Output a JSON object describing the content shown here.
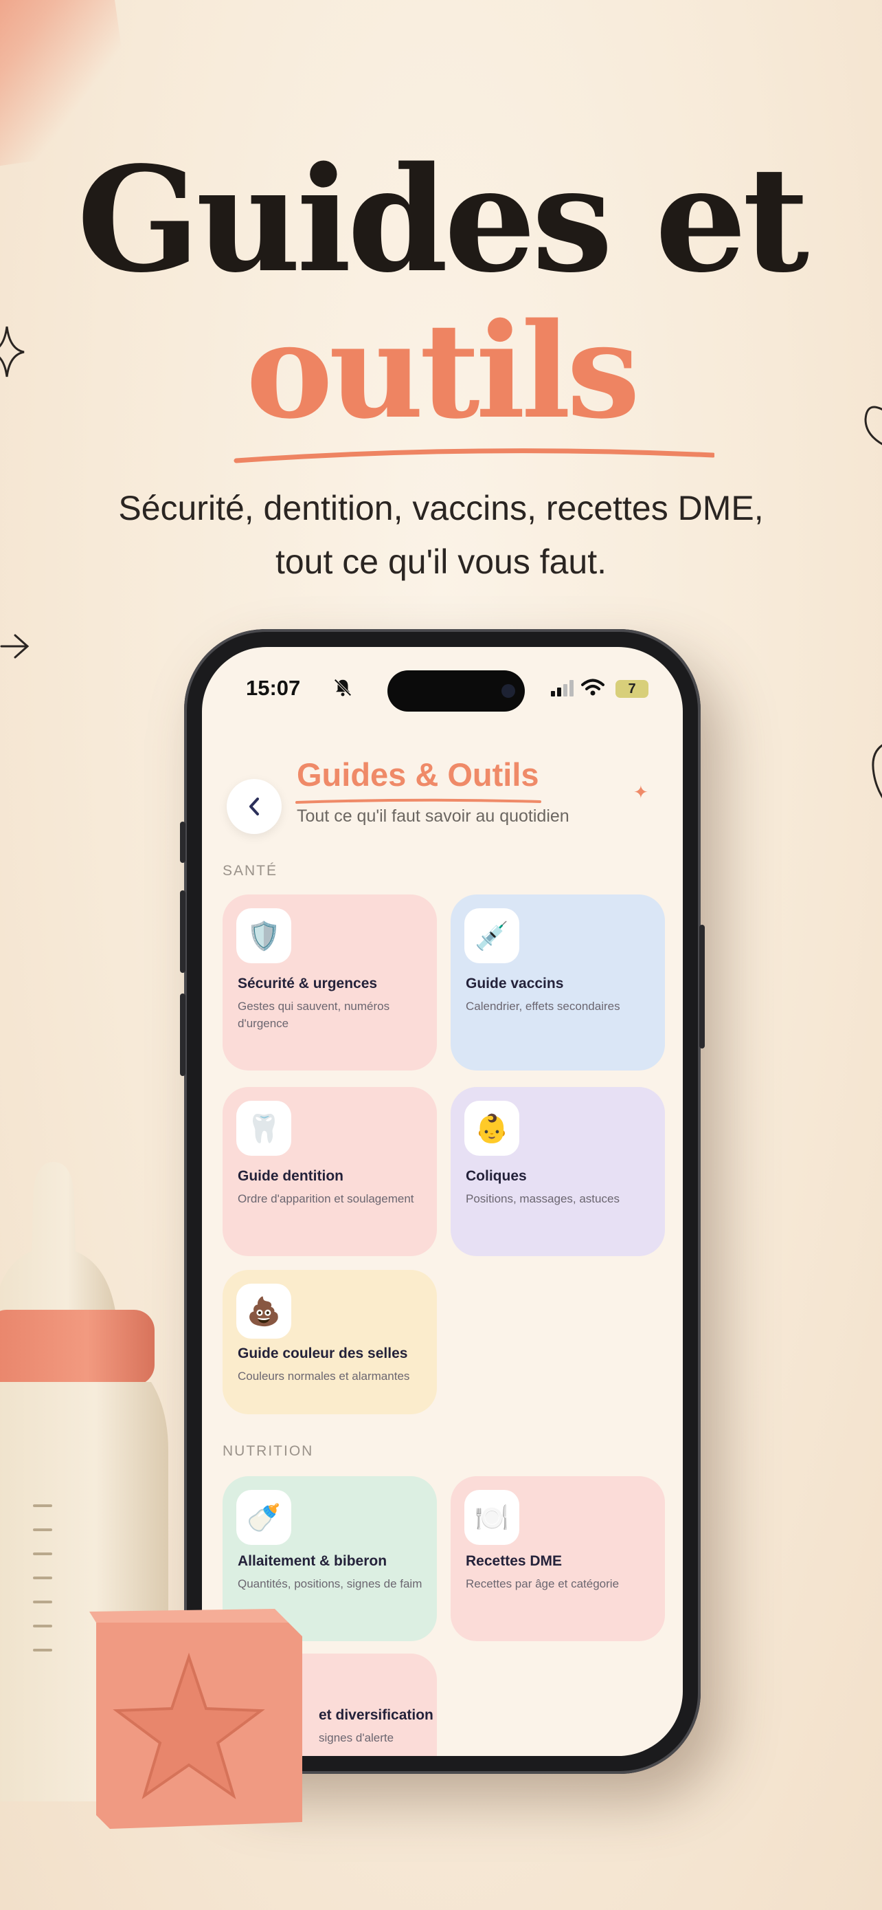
{
  "hero": {
    "title_line1": "Guides et",
    "title_line2": "outils",
    "subtitle_line1": "Sécurité, dentition, vaccins, recettes DME,",
    "subtitle_line2": "tout ce qu'il vous faut."
  },
  "status_bar": {
    "time": "15:07",
    "battery": "7"
  },
  "header": {
    "title": "Guides & Outils",
    "subtitle": "Tout ce qu'il faut savoir au quotidien"
  },
  "sections": [
    {
      "label": "SANTÉ",
      "cards": [
        {
          "icon": "🛡️",
          "icon_name": "shield-icon",
          "title": "Sécurité & urgences",
          "description": "Gestes qui sauvent, numéros d'urgence",
          "color": "#fbdcd8"
        },
        {
          "icon": "💉",
          "icon_name": "syringe-icon",
          "title": "Guide vaccins",
          "description": "Calendrier, effets secondaires",
          "color": "#dae6f6"
        },
        {
          "icon": "🦷",
          "icon_name": "tooth-icon",
          "title": "Guide dentition",
          "description": "Ordre d'apparition et soulagement",
          "color": "#fbdcd8"
        },
        {
          "icon": "👶",
          "icon_name": "baby-icon",
          "title": "Coliques",
          "description": "Positions, massages, astuces",
          "color": "#e7e0f4"
        },
        {
          "icon": "💩",
          "icon_name": "poop-icon",
          "title": "Guide couleur des selles",
          "description": "Couleurs normales et alarmantes",
          "color": "#fbeccc"
        }
      ]
    },
    {
      "label": "NUTRITION",
      "cards": [
        {
          "icon": "🍼",
          "icon_name": "baby-bottle-icon",
          "title": "Allaitement & biberon",
          "description": "Quantités, positions, signes de faim",
          "color": "#dcefe2"
        },
        {
          "icon": "🍽️",
          "icon_name": "plate-icon",
          "title": "Recettes DME",
          "description": "Recettes par âge et catégorie",
          "color": "#fbdcd8"
        },
        {
          "icon": "",
          "icon_name": "diversification-icon",
          "title": "et diversification",
          "description": "signes d'alerte",
          "color": "#fbdcd8"
        }
      ]
    }
  ],
  "colors": {
    "accent": "#ee8462",
    "background": "#f8ecdc",
    "title_dark": "#1f1a16"
  }
}
